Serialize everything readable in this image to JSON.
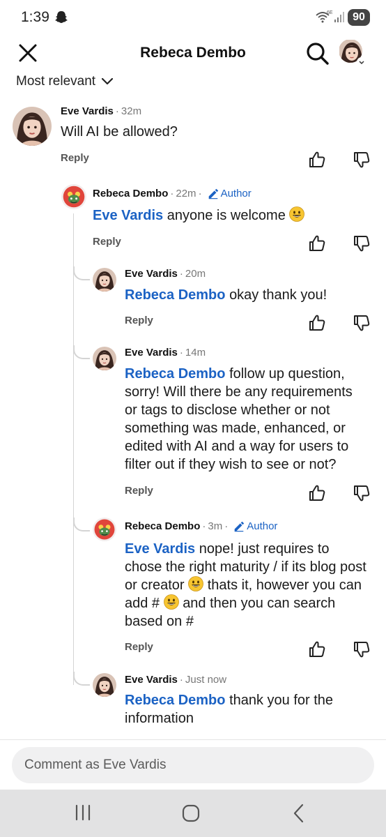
{
  "status_bar": {
    "time": "1:39",
    "battery": "90"
  },
  "header": {
    "title": "Rebeca Dembo"
  },
  "sort": {
    "label": "Most relevant"
  },
  "comments": [
    {
      "author": "Eve Vardis",
      "time": "32m",
      "mention": "",
      "text": "Will AI be allowed?",
      "reply": "Reply"
    },
    {
      "author": "Rebeca Dembo",
      "time": "22m",
      "badge": "Author",
      "mention": "Eve Vardis",
      "text": "anyone is welcome",
      "reply": "Reply"
    },
    {
      "author": "Eve Vardis",
      "time": "20m",
      "mention": "Rebeca Dembo",
      "text": "okay thank you!",
      "reply": "Reply"
    },
    {
      "author": "Eve Vardis",
      "time": "14m",
      "mention": "Rebeca Dembo",
      "text": "follow up question, sorry! Will there be any requirements or tags to disclose whether or not something was made, enhanced, or edited with AI and a way for users to filter out if they wish to see or not?",
      "reply": "Reply"
    },
    {
      "author": "Rebeca Dembo",
      "time": "3m",
      "badge": "Author",
      "mention": "Eve Vardis",
      "text_a": "nope! just requires to chose the right maturity / if its blog post or creator",
      "text_b": "thats it, however you can add #",
      "text_c": "and then you can search based on #",
      "reply": "Reply"
    },
    {
      "author": "Eve Vardis",
      "time": "Just now",
      "mention": "Rebeca Dembo",
      "text": "thank you for the information"
    }
  ],
  "composer": {
    "placeholder": "Comment as Eve Vardis"
  },
  "colors": {
    "mention": "#1b62c4",
    "accent": "#1b62c4",
    "nav_bar": "#e2e2e3"
  },
  "icons": [
    "close-icon",
    "search-icon",
    "chevron-down-icon",
    "thumbs-up-icon",
    "thumbs-down-icon",
    "pencil-icon",
    "smile-emoji-icon"
  ]
}
